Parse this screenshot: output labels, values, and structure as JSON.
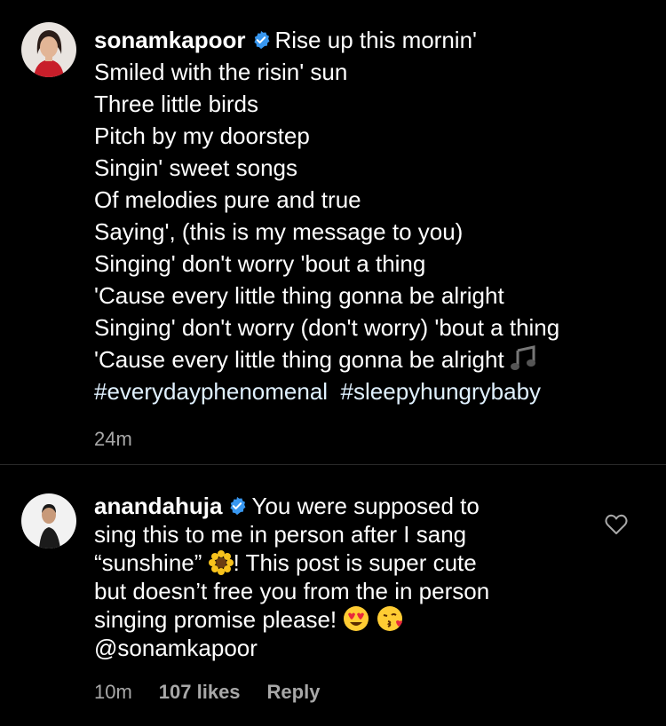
{
  "comments": [
    {
      "username": "sonamkapoor",
      "lines": [
        "Rise up this mornin'",
        "Smiled with the risin' sun",
        "Three little birds",
        "Pitch by my doorstep",
        "Singin' sweet songs",
        "Of melodies pure and true",
        "Saying', (this is my message to you)",
        "Singing' don't worry 'bout a thing",
        "'Cause every little thing gonna be alright",
        "Singing' don't worry (don't worry) 'bout a thing",
        "'Cause every little thing gonna be alright"
      ],
      "hashtag1": "#everydayphenomenal",
      "hashtag2": "#sleepyhungrybaby",
      "time": "24m",
      "trailing_emoji": "music-notes"
    },
    {
      "username": "anandahuja",
      "line1": "You were supposed to",
      "line2": "sing this to me in person after I sang",
      "line3_pre": "“sunshine”",
      "line3_post": "! This post is super cute",
      "line4": "but doesn’t free you from the in person",
      "line5": "singing promise please!",
      "mention": "@sonamkapoor",
      "time": "10m",
      "likes": "107 likes",
      "reply": "Reply",
      "emojis": [
        "sunflower",
        "heart-eyes",
        "face-blowing-kiss"
      ]
    }
  ],
  "colors": {
    "background": "#000000",
    "text": "#ffffff",
    "meta": "#a8a8a8",
    "verified": "#3897f0",
    "hashtag": "#e0f1ff"
  }
}
